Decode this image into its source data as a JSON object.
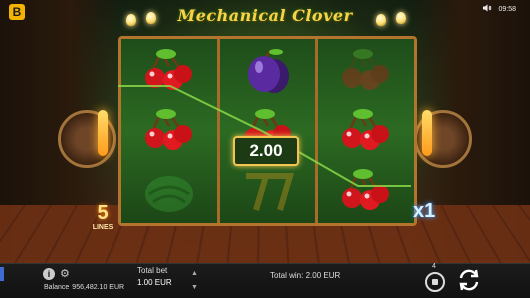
{
  "header": {
    "logo_letter": "B",
    "game_title": "Mechanical Clover",
    "time": "09:58",
    "sound_icon": "speaker-icon"
  },
  "reels": [
    [
      "cherries",
      "cherries",
      "watermelon"
    ],
    [
      "plums",
      "cherries",
      "seven"
    ],
    [
      "cherries",
      "cherries",
      "cherries"
    ]
  ],
  "win_amount": "2.00",
  "lines": {
    "count": "5",
    "label": "LINES"
  },
  "multiplier": "x1",
  "bottom_bar": {
    "balance_label": "Balance",
    "balance_value": "956,482.10 EUR",
    "total_bet_label": "Total bet",
    "total_bet_value": "1.00 EUR",
    "total_win_label": "Total win:",
    "total_win_value": "2.00 EUR",
    "autoplay_count": "4"
  },
  "colors": {
    "accent": "#f2c550",
    "reel_bg": "#2c6a22",
    "frame": "#b3742e"
  }
}
